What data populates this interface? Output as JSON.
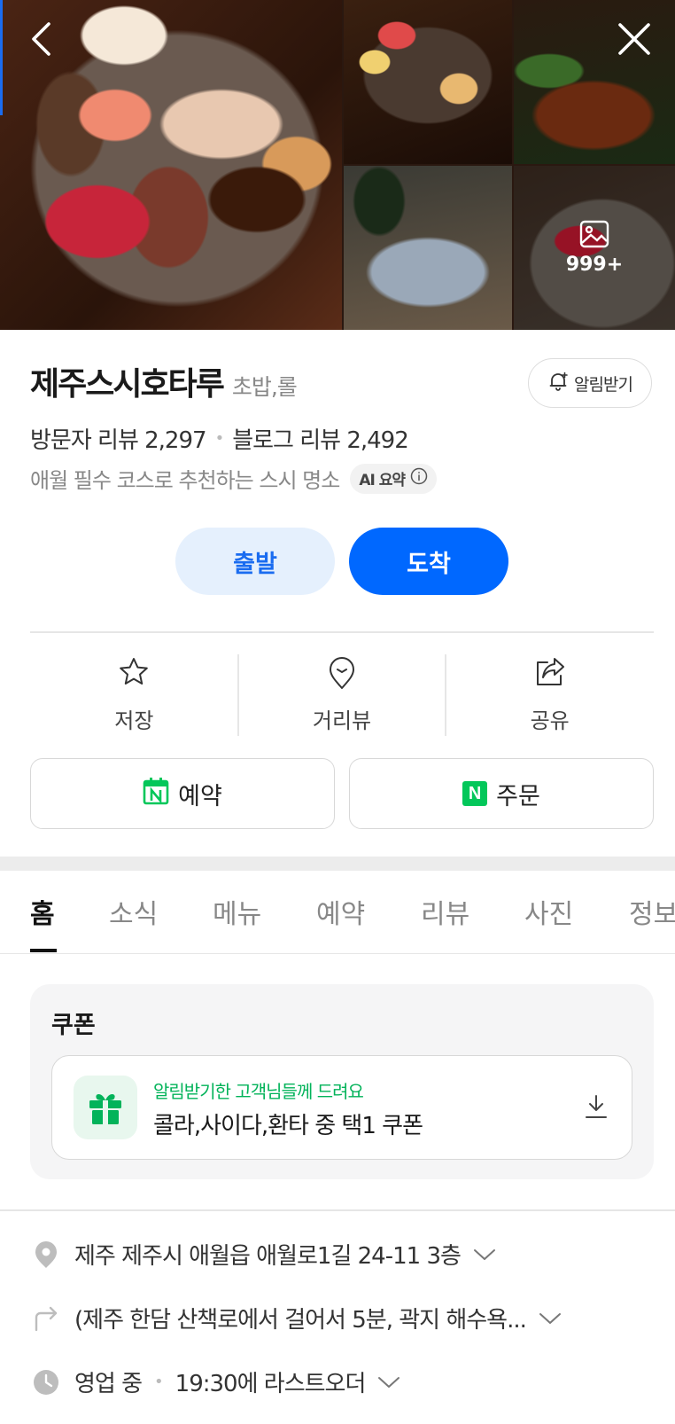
{
  "gallery": {
    "more_count": "999+"
  },
  "place": {
    "name": "제주스시호타루",
    "category": "초밥,롤",
    "alert_label": "알림받기",
    "visitor_reviews": "방문자 리뷰 2,297",
    "blog_reviews": "블로그 리뷰 2,492",
    "summary": "애월 필수 코스로 추천하는 스시 명소",
    "ai_badge": "AI 요약"
  },
  "route": {
    "depart": "출발",
    "arrive": "도착"
  },
  "actions": [
    {
      "label": "저장",
      "icon": "star-icon"
    },
    {
      "label": "거리뷰",
      "icon": "map-pin-icon"
    },
    {
      "label": "공유",
      "icon": "share-icon"
    }
  ],
  "booking": {
    "reserve": "예약",
    "order": "주문",
    "naver_mark": "N"
  },
  "tabs": [
    "홈",
    "소식",
    "메뉴",
    "예약",
    "리뷰",
    "사진",
    "정보"
  ],
  "coupon": {
    "title": "쿠폰",
    "subtitle": "알림받기한 고객님들께 드려요",
    "name": "콜라,사이다,환타 중 택1 쿠폰"
  },
  "info": {
    "address": "제주 제주시 애월읍 애월로1길 24-11 3층",
    "directions": "(제주 한담 산책로에서 걸어서 5분, 곽지 해수욕...",
    "status": "영업 중",
    "last_order": "19:30에 라스트오더"
  },
  "colors": {
    "accent": "#0068ff",
    "accent_light": "#e5f0fd",
    "naver_green": "#03c75a"
  }
}
